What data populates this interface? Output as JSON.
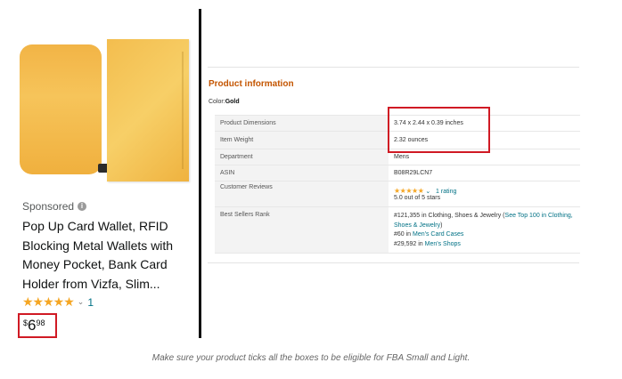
{
  "product": {
    "sponsored_label": "Sponsored",
    "title": "Pop Up Card Wallet, RFID Blocking Metal Wallets with Money Pocket, Bank Card Holder from Vizfa, Slim...",
    "stars": "★★★★★",
    "rating_chevron": "⌄",
    "rating_count": "1",
    "price_currency": "$",
    "price_whole": "6",
    "price_fraction": "98",
    "card_color": "#f4bd4f"
  },
  "product_info": {
    "heading": "Product information",
    "color_label": "Color:",
    "color_value": "Gold",
    "rows": [
      {
        "key": "Product Dimensions",
        "value": "3.74 x 2.44 x 0.39 inches"
      },
      {
        "key": "Item Weight",
        "value": "2.32 ounces"
      },
      {
        "key": "Department",
        "value": "Mens"
      },
      {
        "key": "ASIN",
        "value": "B08R29LCN7"
      },
      {
        "key": "Customer Reviews",
        "stars": "★★★★★",
        "chevron": "⌄",
        "rating_link": "1 rating",
        "rating_text": "5.0 out of 5 stars"
      },
      {
        "key": "Best Sellers Rank",
        "rank1": "#121,355 in Clothing, Shoes & Jewelry (",
        "rank1_link": "See Top 100 in Clothing, Shoes & Jewelry",
        "rank1_end": ")",
        "rank2": "#60 in ",
        "rank2_link": "Men's Card Cases",
        "rank3": "#29,592 in ",
        "rank3_link": "Men's Shops"
      }
    ]
  },
  "caption": "Make sure your product ticks all the boxes to be eligible for FBA Small and Light.",
  "colors": {
    "accent_red": "#d01a24",
    "heading_orange": "#c45500",
    "link_teal": "#007185",
    "star_orange": "#f5a623"
  }
}
